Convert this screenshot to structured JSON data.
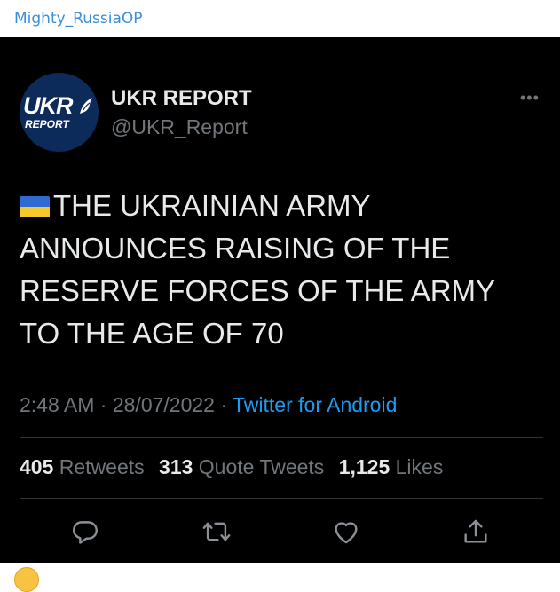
{
  "channel": {
    "name": "Mighty_RussiaOP"
  },
  "tweet": {
    "author": {
      "display_name": "UKR REPORT",
      "handle": "@UKR_Report",
      "avatar_logo_top": "UKR",
      "avatar_logo_bottom": "REPORT"
    },
    "more_label": "•••",
    "text": "THE UKRAINIAN ARMY ANNOUNCES RAISING OF THE RESERVE FORCES OF THE ARMY TO THE AGE OF 70",
    "text_lines": [
      "THE UKRAINIAN ARMY",
      "ANNOUNCES RAISING OF THE",
      "RESERVE FORCES OF THE ARMY",
      "TO THE AGE OF 70"
    ],
    "flag": {
      "name": "ukraine-flag-icon",
      "colors": [
        "#2f6cd0",
        "#f6c92a"
      ]
    },
    "time": "2:48 AM",
    "date": "28/07/2022",
    "separator": "·",
    "source": "Twitter for Android",
    "stats": {
      "retweets_count": "405",
      "retweets_label": "Retweets",
      "quote_count": "313",
      "quote_label": "Quote Tweets",
      "likes_count": "1,125",
      "likes_label": "Likes"
    },
    "actions": [
      "reply-icon",
      "retweet-icon",
      "like-icon",
      "share-icon"
    ]
  },
  "colors": {
    "background": "#000000",
    "text_primary": "#e7e9ea",
    "text_secondary": "#71767b",
    "link": "#1d9bf0",
    "channel_name": "#3a8fd6"
  }
}
